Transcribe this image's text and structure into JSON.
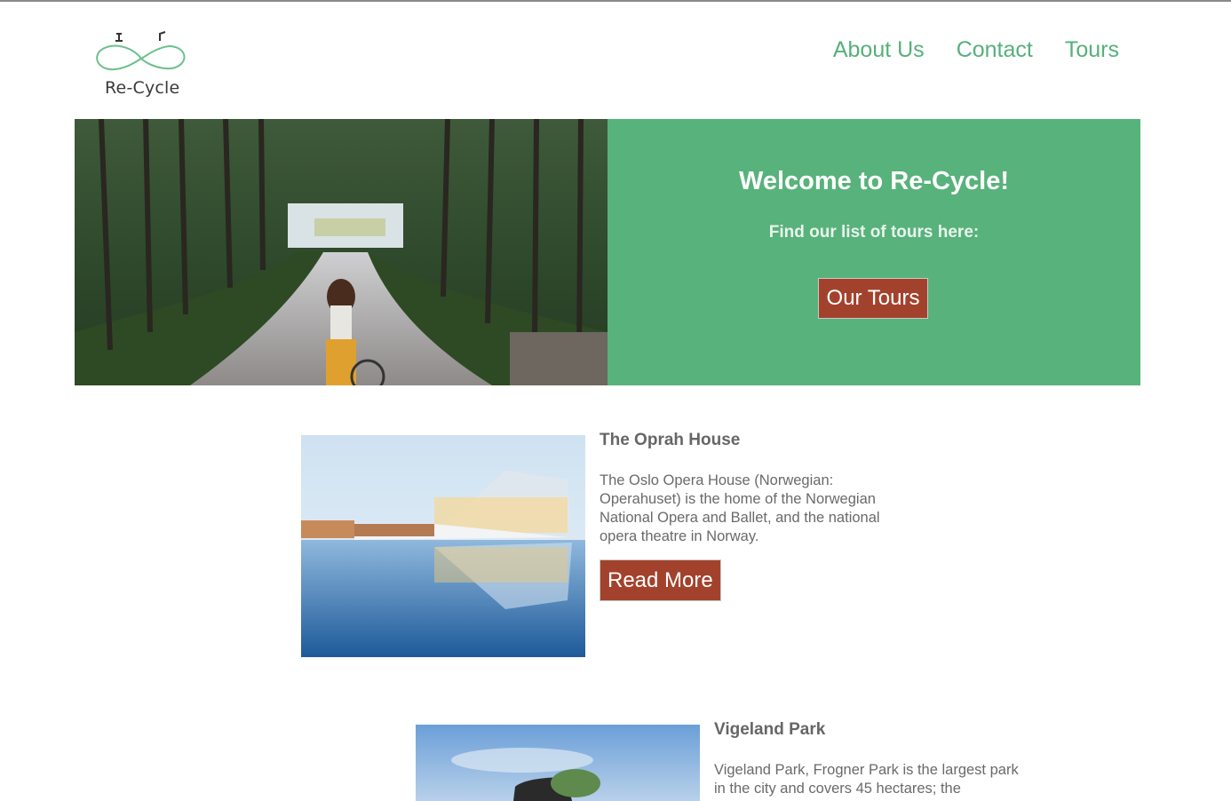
{
  "header": {
    "logo_text": "Re-Cycle",
    "nav": [
      "About Us",
      "Contact",
      "Tours"
    ]
  },
  "hero": {
    "title": "Welcome to Re-Cycle!",
    "subtitle": "Find our list of tours here:",
    "button_label": "Our Tours"
  },
  "tours": [
    {
      "title": "The Oprah House",
      "description": "The Oslo Opera House (Norwegian: Operahuset) is the home of the Norwegian National Opera and Ballet, and the national opera theatre in Norway.",
      "button_label": "Read More"
    },
    {
      "title": "Vigeland Park",
      "description": "Vigeland Park, Frogner Park is the largest park in the city and covers 45 hectares; the"
    }
  ],
  "colors": {
    "brand_green": "#58b27b",
    "nav_green": "#56b07a",
    "button_red": "#a3422c"
  }
}
